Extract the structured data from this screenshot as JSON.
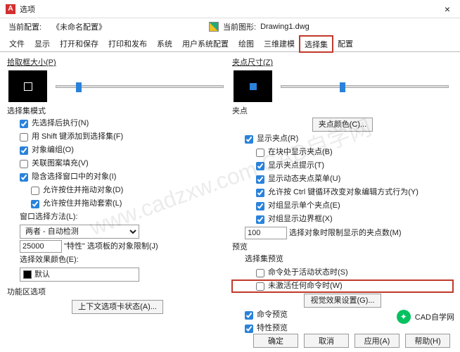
{
  "title": "选项",
  "topbar": {
    "cur_profile_lbl": "当前配置:",
    "cur_profile": "《未命名配置》",
    "cur_drawing_lbl": "当前图形:",
    "cur_drawing": "Drawing1.dwg"
  },
  "tabs": [
    "文件",
    "显示",
    "打开和保存",
    "打印和发布",
    "系统",
    "用户系统配置",
    "绘图",
    "三维建模",
    "选择集",
    "配置"
  ],
  "active_tab": 8,
  "left": {
    "pickbox_lbl": "拾取框大小(P)",
    "selmode_lbl": "选择集模式",
    "cb_noun_verb": "先选择后执行(N)",
    "cb_shift_add": "用 Shift 键添加到选择集(F)",
    "cb_obj_group": "对象编组(O)",
    "cb_hatch_assoc": "关联图案填充(V)",
    "cb_implied_window": "隐含选择窗口中的对象(I)",
    "cb_allow_drag": "允许按住并拖动对象(D)",
    "cb_allow_lasso": "允许按住并拖动套索(L)",
    "winselect_lbl": "窗口选择方法(L):",
    "winselect_val": "两者 - 自动检测",
    "limit_val": "25000",
    "limit_lbl": "\"特性\" 选项板的对象限制(J)",
    "sel_color_lbl": "选择效果颜色(E):",
    "sel_color_val": "默认",
    "ribbon_lbl": "功能区选项",
    "ctx_tab_btn": "上下文选项卡状态(A)..."
  },
  "right": {
    "gripsize_lbl": "夹点尺寸(Z)",
    "grips_lbl": "夹点",
    "gripcolor_btn": "夹点颜色(C)...",
    "cb_show_grips": "显示夹点(R)",
    "cb_grips_in_block": "在块中显示夹点(B)",
    "cb_grip_tips": "显示夹点提示(T)",
    "cb_dyn_grip_menu": "显示动态夹点菜单(U)",
    "cb_ctrl_cycle": "允许按 Ctrl 键循环改变对象编辑方式行为(Y)",
    "cb_single_grip_group": "对组显示单个夹点(E)",
    "cb_group_bbox": "对组显示边界框(X)",
    "grip_limit_val": "100",
    "grip_limit_lbl": "选择对象时限制显示的夹点数(M)",
    "preview_lbl": "预览",
    "sel_preview_lbl": "选择集预览",
    "cb_cmd_active": "命令处于活动状态时(S)",
    "cb_no_cmd": "未激活任何命令时(W)",
    "vis_fx_btn": "视觉效果设置(G)...",
    "cb_cmd_preview": "命令预览",
    "cb_prop_preview": "特性预览"
  },
  "footer": {
    "ok": "确定",
    "cancel": "取消",
    "apply": "应用(A)",
    "help": "帮助(H)"
  },
  "watermark": "www.cadzxw.com  CAD自学网",
  "share": "CAD自学网"
}
